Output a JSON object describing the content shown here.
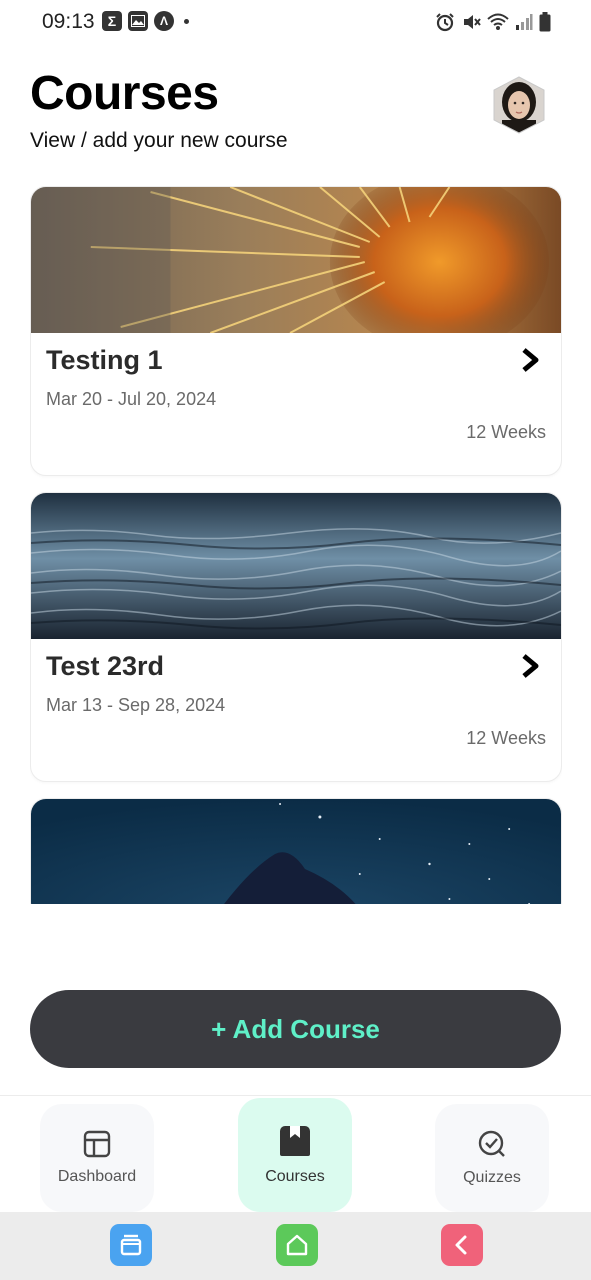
{
  "status_bar": {
    "time": "09:13",
    "left_icons": [
      "sigma-icon",
      "image-icon",
      "a-icon",
      "dot-icon"
    ],
    "right_icons": [
      "alarm-icon",
      "mute-icon",
      "wifi-icon",
      "signal-icon",
      "battery-icon"
    ]
  },
  "header": {
    "title": "Courses",
    "subtitle": "View / add your new course"
  },
  "courses": [
    {
      "name": "Testing 1",
      "dates": "Mar 20 - Jul 20, 2024",
      "duration": "12 Weeks",
      "image": "cactus-photo"
    },
    {
      "name": "Test 23rd",
      "dates": "Mar 13 - Sep 28, 2024",
      "duration": "12 Weeks",
      "image": "ocean-photo"
    },
    {
      "name": "",
      "dates": "",
      "duration": "",
      "image": "night-sky-photo"
    }
  ],
  "add_button": {
    "label": "+ Add Course"
  },
  "bottom_nav": {
    "items": [
      {
        "label": "Dashboard",
        "icon": "dashboard-icon",
        "active": false
      },
      {
        "label": "Courses",
        "icon": "book-icon",
        "active": true
      },
      {
        "label": "Quizzes",
        "icon": "quiz-icon",
        "active": false
      }
    ]
  },
  "system_nav": {
    "buttons": [
      "recents-icon",
      "home-icon",
      "back-icon"
    ]
  },
  "colors": {
    "accent": "#5ff0c8",
    "button_bg": "#3a3b40",
    "active_nav_bg": "#dbfbef"
  }
}
